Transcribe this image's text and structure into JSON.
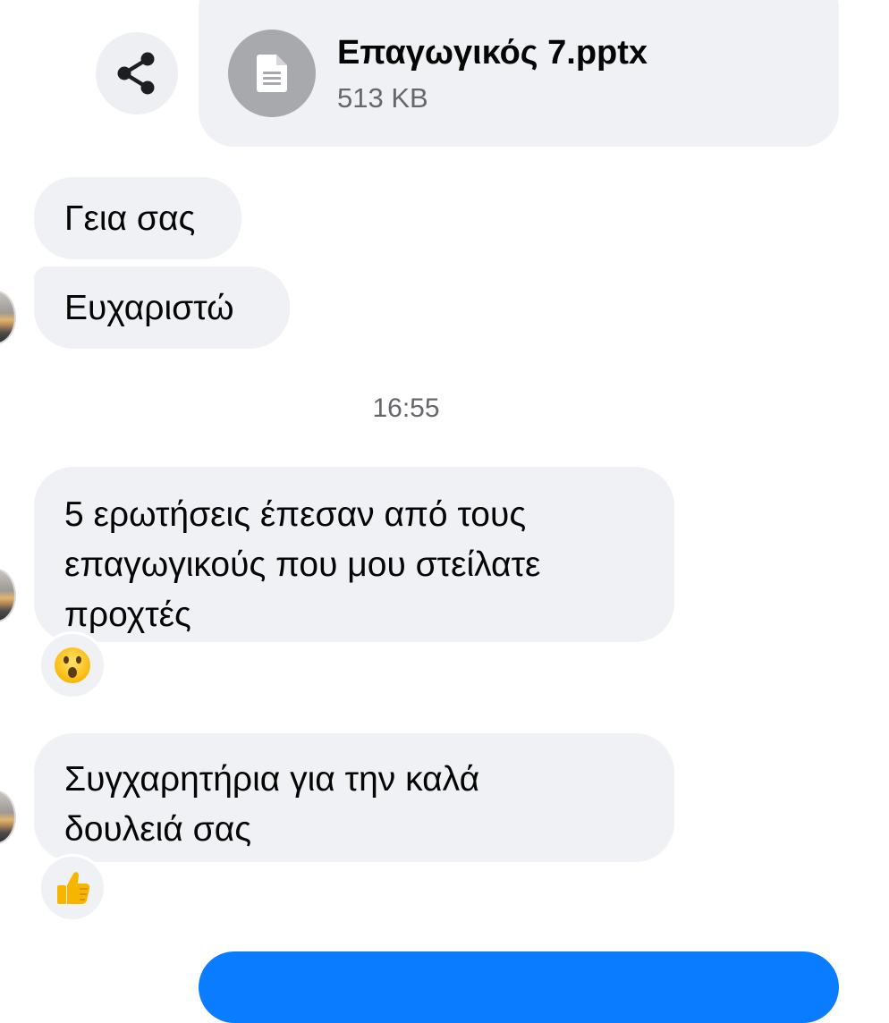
{
  "attachment": {
    "file_name": "Επαγωγικός 7.pptx",
    "file_size": "513 KB",
    "icon": "document-icon"
  },
  "share_icon": "share-icon",
  "messages": [
    {
      "text_lines": [
        "Γεια σας"
      ],
      "direction": "received"
    },
    {
      "text_lines": [
        "Ευχαριστώ"
      ],
      "direction": "received"
    },
    {
      "text_lines": [
        "5 ερωτήσεις έπεσαν από τους",
        "επαγωγικούς που μου στείλατε",
        "προχτές"
      ],
      "direction": "received",
      "reaction": "😮"
    },
    {
      "text_lines": [
        "Συγχαρητήρια για την καλά",
        "δουλειά σας"
      ],
      "direction": "received",
      "reaction": "👍"
    }
  ],
  "timestamp": "16:55",
  "colors": {
    "received_bubble": "#f0f1f4",
    "sent_bubble": "#0a7cff",
    "secondary_text": "#65676b"
  }
}
